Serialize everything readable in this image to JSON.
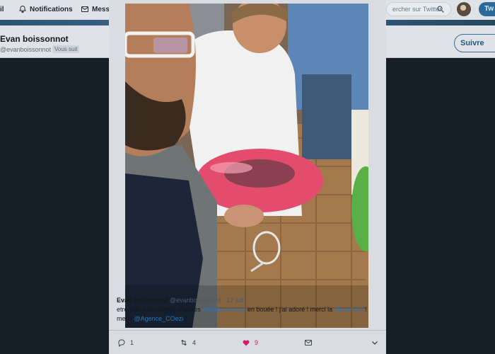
{
  "topnav": {
    "first_label": "il",
    "notifications_label": "Notifications",
    "messages_label": "Messa",
    "search_placeholder": "ercher sur Twitter",
    "tweet_label": "Tw"
  },
  "profile": {
    "name": "Evan boissonnot",
    "handle": "@evanboissonnot",
    "follows_you": "Vous suit",
    "follow_label": "Suivre"
  },
  "tweet": {
    "author_name": "Evan boissonnot",
    "author_handle": "@evanboissonnot",
    "date": "12 juil.",
    "text_part1": "etre prêt a rencontrer d'autres ",
    "hashtag": "#entrepreneurs",
    "text_part2": " en bouée ! j'ai adoré ! merci la ",
    "mention1": "@cpme44",
    "text_part3": " ! merci ",
    "mention2": "@Agence_COezi",
    "text_part4": " !",
    "replies": "1",
    "retweets": "4",
    "likes": "9"
  },
  "icons": {
    "bell": "bell-icon",
    "mail": "mail-icon",
    "search": "search-icon",
    "reply": "reply-icon",
    "retweet": "retweet-icon",
    "like": "heart-icon",
    "dm": "envelope-icon",
    "more": "chevron-down-icon"
  },
  "colors": {
    "like": "#d21c6a",
    "link": "#2b75b8",
    "accent": "#1da1f2"
  }
}
